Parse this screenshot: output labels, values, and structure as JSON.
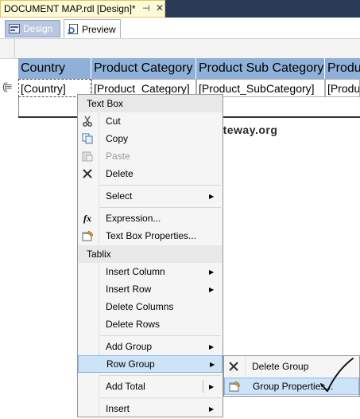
{
  "doc_tab": {
    "title": "DOCUMENT MAP.rdl [Design]*",
    "pin": "⊣",
    "close": "✕"
  },
  "view_tabs": {
    "design": "Design",
    "preview": "Preview"
  },
  "tablix": {
    "headers": [
      "Country",
      "Product Category",
      "Product Sub Category",
      "Produ"
    ],
    "cells": [
      "[Country]",
      "[Product_Category]",
      "[Product_SubCategory]",
      "[Produ"
    ],
    "row_marker": "((≡"
  },
  "watermark": "©tutorialgateway.org",
  "context_menu": {
    "section_textbox": "Text Box",
    "cut": "Cut",
    "copy": "Copy",
    "paste": "Paste",
    "delete": "Delete",
    "select": "Select",
    "expression": "Expression...",
    "textbox_properties": "Text Box Properties...",
    "section_tablix": "Tablix",
    "insert_column": "Insert Column",
    "insert_row": "Insert Row",
    "delete_columns": "Delete Columns",
    "delete_rows": "Delete Rows",
    "add_group": "Add Group",
    "row_group": "Row Group",
    "add_total": "Add Total",
    "insert": "Insert"
  },
  "submenu": {
    "delete_group": "Delete Group",
    "group_properties": "Group Properties..."
  },
  "icons": {
    "cut": "scissors-icon",
    "copy": "copy-icon",
    "paste": "paste-icon",
    "delete": "delete-x-icon",
    "expression": "fx-icon",
    "properties": "properties-icon"
  },
  "colors": {
    "header_fill": "#8fb0d9",
    "highlight": "#cde3f7",
    "tab_active": "#fefbd7"
  }
}
